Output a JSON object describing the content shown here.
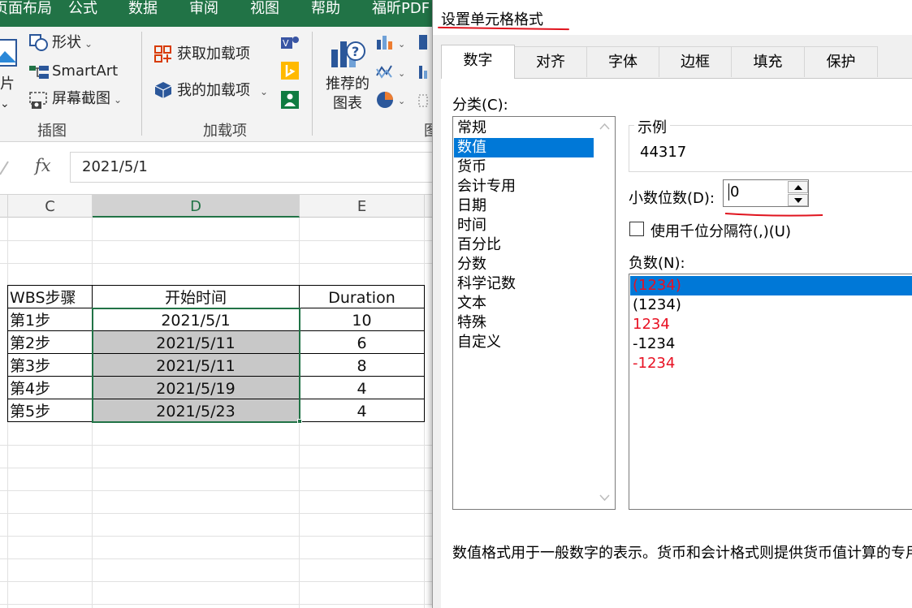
{
  "ribbon_tabs": [
    "页面布局",
    "公式",
    "数据",
    "审阅",
    "视图",
    "帮助",
    "福昕PDF"
  ],
  "ribbon": {
    "picture_partial": "片",
    "shapes": "形状",
    "smartart": "SmartArt",
    "screenshot": "屏幕截图",
    "get_addins": "获取加载项",
    "my_addins": "我的加载项",
    "recommended_charts_line1": "推荐的",
    "recommended_charts_line2": "图表",
    "group_illustrations": "插图",
    "group_addins": "加载项",
    "group_charts_partial": "图"
  },
  "formula_bar": {
    "fx": "fx",
    "value": "2021/5/1"
  },
  "columns": [
    "C",
    "D",
    "E"
  ],
  "table": {
    "headers": [
      "WBS步骤",
      "开始时间",
      "Duration"
    ],
    "rows": [
      [
        "第1步",
        "2021/5/1",
        "10"
      ],
      [
        "第2步",
        "2021/5/11",
        "6"
      ],
      [
        "第3步",
        "2021/5/11",
        "8"
      ],
      [
        "第4步",
        "2021/5/19",
        "4"
      ],
      [
        "第5步",
        "2021/5/23",
        "4"
      ]
    ]
  },
  "dialog": {
    "title": "设置单元格格式",
    "tabs": [
      "数字",
      "对齐",
      "字体",
      "边框",
      "填充",
      "保护"
    ],
    "active_tab": "数字",
    "category_label": "分类(C):",
    "categories": [
      "常规",
      "数值",
      "货币",
      "会计专用",
      "日期",
      "时间",
      "百分比",
      "分数",
      "科学记数",
      "文本",
      "特殊",
      "自定义"
    ],
    "selected_category": "数值",
    "sample_label": "示例",
    "sample_value": "44317",
    "decimal_label": "小数位数(D):",
    "decimal_value": "0",
    "thousand_separator_label": "使用千位分隔符(,)(U)",
    "negative_label": "负数(N):",
    "negative_options": [
      "(1234)",
      "(1234)",
      "1234",
      "-1234",
      "-1234"
    ],
    "description": "数值格式用于一般数字的表示。货币和会计格式则提供货币值计算的专用"
  },
  "colors": {
    "excel_green": "#217346",
    "selection_blue": "#0078d7",
    "negative_red": "#e81123",
    "annotation_red": "#e0141e",
    "selected_cell_fill": "#c8c8c8"
  }
}
